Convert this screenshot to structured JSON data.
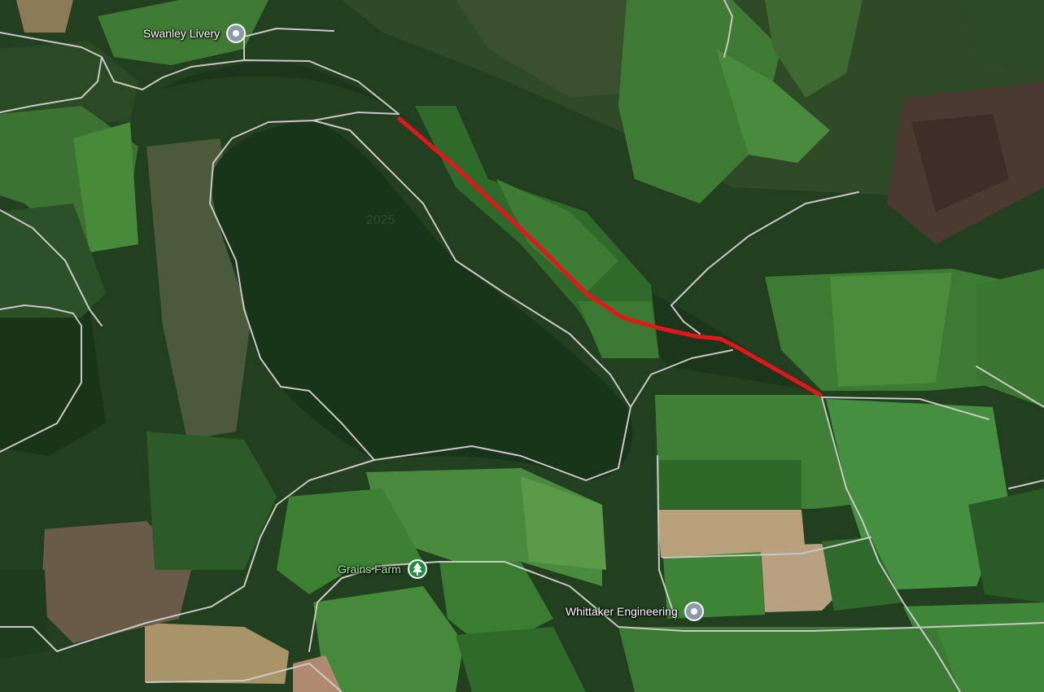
{
  "map": {
    "route_color": "#e8141c",
    "watermark": "2025",
    "places": [
      {
        "name": "Swanley Livery",
        "icon": "place-pin-icon",
        "color": "#8a9aa8"
      },
      {
        "name": "Grains Farm",
        "icon": "tree-icon",
        "color": "#1e8e3e"
      },
      {
        "name": "Whittaker Engineering",
        "icon": "place-pin-icon",
        "color": "#8a9aa8"
      }
    ]
  }
}
